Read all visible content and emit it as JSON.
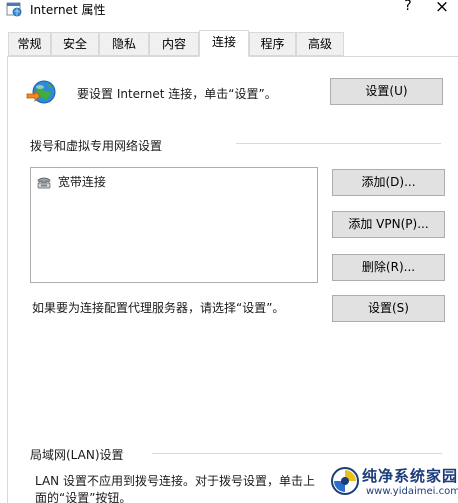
{
  "window": {
    "title": "Internet 属性",
    "help_glyph": "?",
    "close_glyph": "×"
  },
  "tabs": [
    {
      "label": "常规"
    },
    {
      "label": "安全"
    },
    {
      "label": "隐私"
    },
    {
      "label": "内容"
    },
    {
      "label": "连接",
      "active": true
    },
    {
      "label": "程序"
    },
    {
      "label": "高级"
    }
  ],
  "setup": {
    "description": "要设置 Internet 连接，单击“设置”。",
    "button_label": "设置(U)"
  },
  "dialup": {
    "section_label": "拨号和虚拟专用网络设置",
    "connections": [
      {
        "name": "宽带连接"
      }
    ],
    "buttons": {
      "add": "添加(D)...",
      "add_vpn": "添加 VPN(P)...",
      "remove": "删除(R)...",
      "settings": "设置(S)"
    },
    "proxy_description": "如果要为连接配置代理服务器，请选择“设置”。"
  },
  "lan": {
    "section_label": "局域网(LAN)设置",
    "description": "LAN 设置不应用到拨号连接。对于拨号设置，单击上面的“设置”按钮。"
  },
  "watermark": {
    "title": "纯净系统家园",
    "url": "www.yidaimei.com"
  },
  "colors": {
    "button_face": "#e1e1e1",
    "button_border": "#adadad",
    "separator": "#d9d9d9",
    "watermark_blue": "#1c3d7a"
  }
}
